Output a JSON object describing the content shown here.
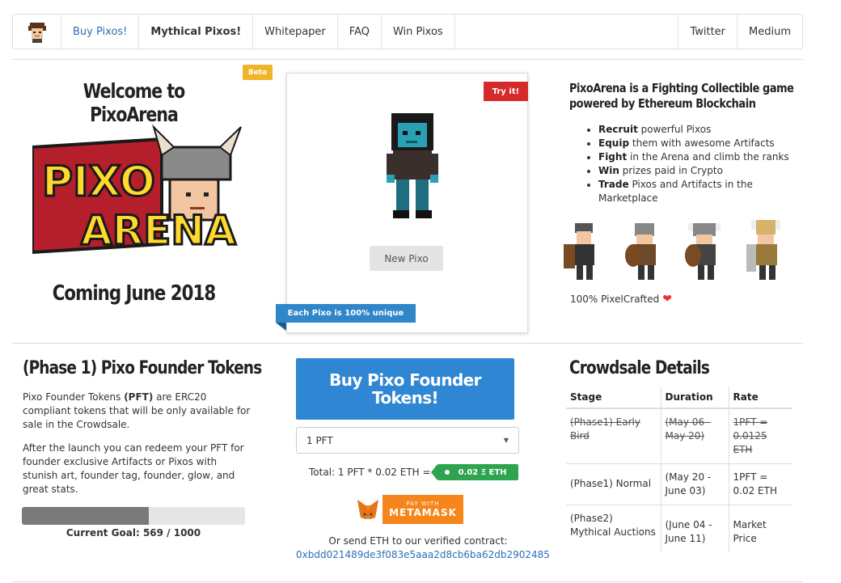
{
  "nav": {
    "items": [
      {
        "label": "Buy Pixos!"
      },
      {
        "label": "Mythical Pixos!"
      },
      {
        "label": "Whitepaper"
      },
      {
        "label": "FAQ"
      },
      {
        "label": "Win Pixos"
      }
    ],
    "right_items": [
      {
        "label": "Twitter"
      },
      {
        "label": "Medium"
      }
    ]
  },
  "hero": {
    "title": "Welcome to PixoArena",
    "logo_text_top": "PIXO",
    "logo_text_bottom": "ARENA",
    "coming": "Coming June 2018"
  },
  "card": {
    "beta": "Beta",
    "try_it": "Try it!",
    "new_pixo": "New Pixo",
    "unique": "Each Pixo is 100% unique"
  },
  "about": {
    "heading": "PixoArena is a Fighting Collectible game powered by Ethereum Blockchain",
    "features": [
      {
        "bold": "Recruit",
        "rest": " powerful Pixos"
      },
      {
        "bold": "Equip",
        "rest": " them with awesome Artifacts"
      },
      {
        "bold": "Fight",
        "rest": " in the Arena and climb the ranks"
      },
      {
        "bold": "Win",
        "rest": " prizes paid in Crypto"
      },
      {
        "bold": "Trade",
        "rest": " Pixos and Artifacts in the Marketplace"
      }
    ],
    "crafted": "100% PixelCrafted"
  },
  "phase": {
    "title": "(Phase 1) Pixo Founder Tokens",
    "p1_pre": "Pixo Founder Tokens ",
    "p1_bold": "(PFT)",
    "p1_post": " are ERC20 compliant tokens that will be only available for sale in the Crowdsale.",
    "p2": "After the launch you can redeem your PFT for founder exclusive Artifacts or Pixos with stunish art, founder tag, founder, glow, and great stats.",
    "goal_label": "Current Goal: 569 / 1000",
    "goal_current": 569,
    "goal_total": 1000
  },
  "buy": {
    "button": "Buy Pixo Founder Tokens!",
    "select_value": "1 PFT",
    "total": "Total: 1 PFT * 0.02 ETH =",
    "eth_value": "0.02 Ξ ETH",
    "metamask_top": "PAY WITH",
    "metamask_bottom": "METAMASK",
    "send_text": "Or send ETH to our verified contract:",
    "address": "0xbdd021489de3f083e5aaa2d8cb6ba62db2902485"
  },
  "crowdsale": {
    "title": "Crowdsale Details",
    "headers": [
      "Stage",
      "Duration",
      "Rate"
    ],
    "rows": [
      {
        "stage": "(Phase1) Early Bird",
        "duration": "(May 06 - May 20)",
        "rate": "1PFT = 0.0125 ETH",
        "struck": true
      },
      {
        "stage": "(Phase1) Normal",
        "duration": "(May 20 - June 03)",
        "rate": "1PFT = 0.02 ETH",
        "struck": false
      },
      {
        "stage": "(Phase2) Mythical Auctions",
        "duration": "(June 04 - June 11)",
        "rate": "Market Price",
        "struck": false
      }
    ]
  },
  "colors": {
    "link": "#2a6fb5",
    "buy_button": "#2f86d2",
    "try_it": "#d42a2a",
    "beta": "#f0b429",
    "eth_pill": "#2ea44f",
    "metamask": "#f6851b"
  }
}
